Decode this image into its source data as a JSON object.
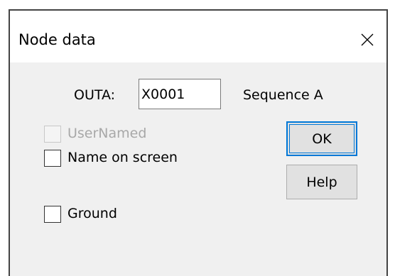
{
  "dialog": {
    "title": "Node data",
    "close_icon": "close-icon"
  },
  "node": {
    "label": "OUTA:",
    "value": "X0001",
    "sequence": "Sequence A"
  },
  "checkboxes": {
    "user_named": {
      "label": "UserNamed",
      "checked": false,
      "enabled": false
    },
    "name_on_screen": {
      "label": "Name on screen",
      "checked": false,
      "enabled": true
    },
    "ground": {
      "label": "Ground",
      "checked": false,
      "enabled": true
    }
  },
  "buttons": {
    "ok": "OK",
    "help": "Help"
  },
  "colors": {
    "focus_border": "#0078d7",
    "dialog_background": "#f0f0f0",
    "disabled_text": "#a8a8a8"
  }
}
